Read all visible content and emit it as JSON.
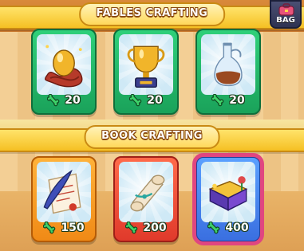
{
  "header": {
    "bag_label": "BAG"
  },
  "sections": {
    "fables": {
      "title": "FABLES CRAFTING",
      "items": [
        {
          "name": "golden-egg",
          "cost": "20",
          "color": "#1aa25a"
        },
        {
          "name": "golden-trophy",
          "cost": "20",
          "color": "#1aa25a"
        },
        {
          "name": "potion-flask",
          "cost": "20",
          "color": "#1aa25a"
        }
      ]
    },
    "book": {
      "title": "BOOK CRAFTING",
      "items": [
        {
          "name": "quill-and-letter",
          "cost": "150",
          "color": "#f08a16"
        },
        {
          "name": "scroll",
          "cost": "200",
          "color": "#e03a2b"
        },
        {
          "name": "magic-book",
          "cost": "400",
          "color": "#3a6fe0"
        }
      ]
    }
  },
  "icons": {
    "currency": "green-bone-icon",
    "bag": "bag-icon"
  }
}
